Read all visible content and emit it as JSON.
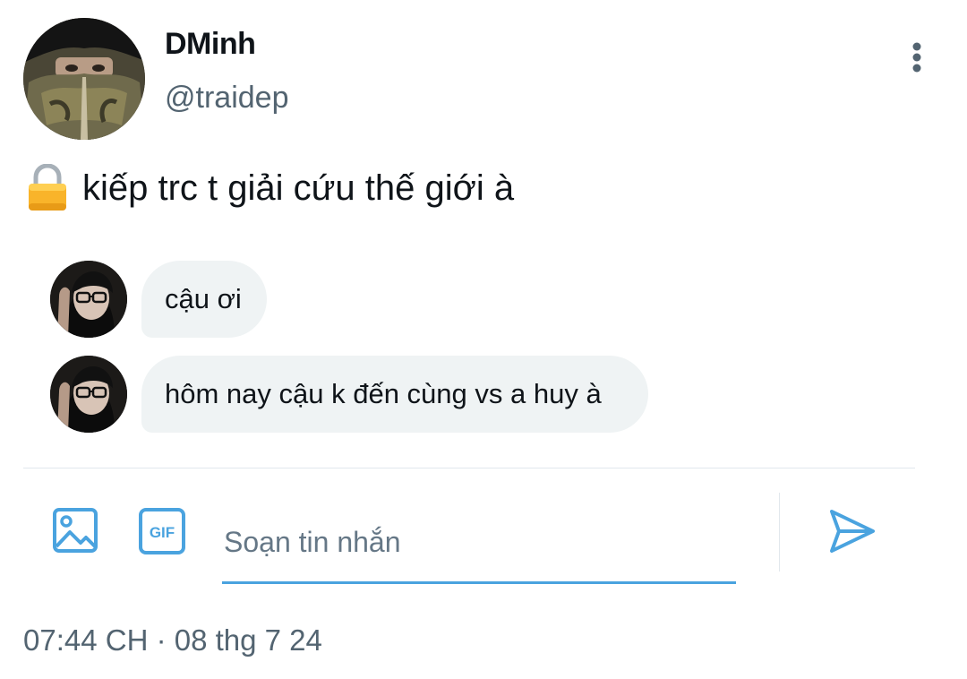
{
  "profile": {
    "display_name": "DMinh",
    "handle": "@traidep",
    "avatar_icon": "user-avatar-photo"
  },
  "tweet": {
    "emoji_icon": "lock-icon",
    "text": "kiếp trc t giải cứu thế giới à"
  },
  "messages": [
    {
      "text": "cậu ơi",
      "avatar_icon": "sender-avatar-photo"
    },
    {
      "text": "hôm nay cậu k đến cùng vs a huy à",
      "avatar_icon": "sender-avatar-photo"
    }
  ],
  "composer": {
    "placeholder": "Soạn tin nhắn",
    "gif_label": "GIF",
    "media_icon": "image-icon",
    "send_icon": "send-icon"
  },
  "timestamp": "07:44 CH · 08 thg 7 24",
  "colors": {
    "accent": "#4aa3df",
    "text_primary": "#0f1419",
    "text_secondary": "#536471",
    "bubble_bg": "#eff3f4"
  }
}
